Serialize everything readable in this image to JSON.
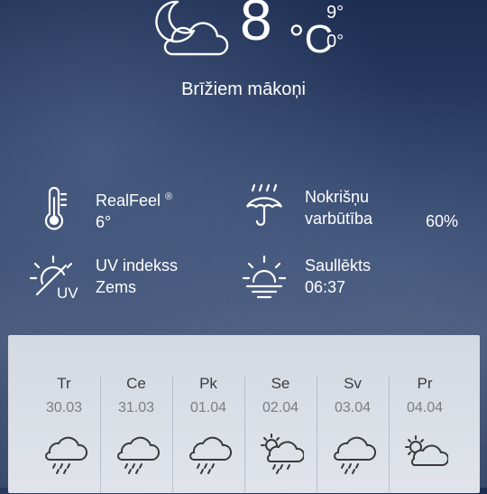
{
  "current": {
    "icon": "moon-cloud-icon",
    "temp": "8",
    "unit": "°C",
    "high": "9°",
    "low": "0°",
    "condition": "Brīžiem mākoņi"
  },
  "details": [
    {
      "icon": "thermometer-icon",
      "label": "RealFeel",
      "sup": "®",
      "value": "6°"
    },
    {
      "icon": "umbrella-rain-icon",
      "label": "Nokrišņu",
      "label2": "varbūtība",
      "value": "60%"
    },
    {
      "icon": "uv-icon",
      "label": "UV indekss",
      "value": "Zems",
      "icon_text": "UV"
    },
    {
      "icon": "sunrise-icon",
      "label": "Saullēkts",
      "value": "06:37"
    }
  ],
  "forecast": [
    {
      "day": "Tr",
      "date": "30.03",
      "icon": "cloud-rain-icon"
    },
    {
      "day": "Ce",
      "date": "31.03",
      "icon": "cloud-rain-icon"
    },
    {
      "day": "Pk",
      "date": "01.04",
      "icon": "cloud-rain-icon"
    },
    {
      "day": "Se",
      "date": "02.04",
      "icon": "sun-cloud-rain-icon"
    },
    {
      "day": "Sv",
      "date": "03.04",
      "icon": "cloud-rain-icon"
    },
    {
      "day": "Pr",
      "date": "04.04",
      "icon": "sun-cloud-icon"
    }
  ]
}
